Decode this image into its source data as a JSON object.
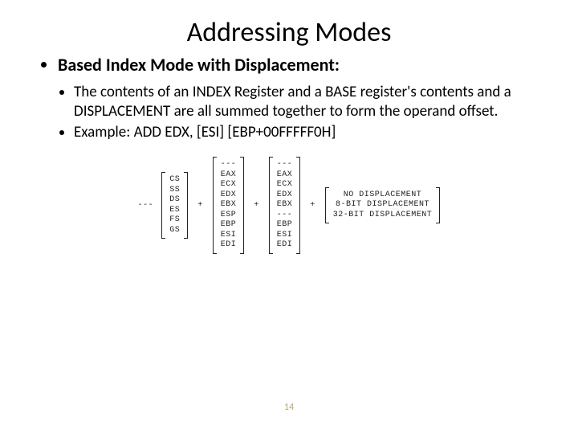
{
  "title": "Addressing Modes",
  "heading": "Based Index Mode with Displacement:",
  "bullets": {
    "b1": "The contents of an INDEX Register and a BASE register's contents and a DISPLACEMENT are all summed together to form the operand offset.",
    "b2": "Example: ADD EDX, [ESI] [EBP+00FFFFF0H]"
  },
  "diagram": {
    "dash": "---",
    "plus": "+",
    "seg": {
      "r0": "CS",
      "r1": "SS",
      "r2": "DS",
      "r3": "ES",
      "r4": "FS",
      "r5": "GS"
    },
    "base": {
      "r0": "EAX",
      "r1": "ECX",
      "r2": "EDX",
      "r3": "EBX",
      "r4": "ESP",
      "r5": "EBP",
      "r6": "ESI",
      "r7": "EDI"
    },
    "index": {
      "r0": "EAX",
      "r1": "ECX",
      "r2": "EDX",
      "r3": "EBX",
      "r4": "---",
      "r5": "EBP",
      "r6": "ESI",
      "r7": "EDI"
    },
    "disp": {
      "d0": "NO DISPLACEMENT",
      "d1": "8-BIT DISPLACEMENT",
      "d2": "32-BIT DISPLACEMENT"
    }
  },
  "page_number": "14"
}
